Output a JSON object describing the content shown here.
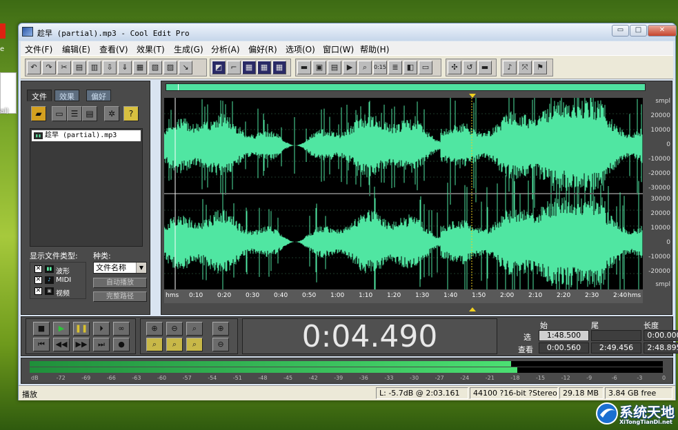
{
  "desktop": {
    "left_label": "al)"
  },
  "window": {
    "title": "趁早 (partial).mp3 - Cool Edit Pro"
  },
  "window_buttons": {
    "minimize": "▭",
    "maximize": "□",
    "close": "✕"
  },
  "menu": [
    {
      "label": "文件(F)"
    },
    {
      "label": "编辑(E)"
    },
    {
      "label": "查看(V)"
    },
    {
      "label": "效果(T)"
    },
    {
      "label": "生成(G)"
    },
    {
      "label": "分析(A)"
    },
    {
      "label": "偏好(R)"
    },
    {
      "label": "选项(O)"
    },
    {
      "label": "窗口(W)"
    },
    {
      "label": "帮助(H)"
    }
  ],
  "toolbar_icons": [
    "undo-icon",
    "redo-icon",
    "cut-icon",
    "copy-icon",
    "paste-icon",
    "paste-new-icon",
    "mix-paste-icon",
    "trim-icon",
    "save-icon",
    "import-icon",
    "export-icon",
    "envelope-icon",
    "scale-icon",
    "grid-icon",
    "grid2-icon",
    "grid3-icon",
    "view-wave-icon",
    "view-spectral-icon",
    "view-pan-icon",
    "play-view-icon",
    "zoom-view-icon",
    "time-icon",
    "bars-icon",
    "color-icon",
    "blank-icon",
    "fx-icon",
    "loop-icon",
    "minus-icon",
    "cd-icon",
    "snap-icon",
    "flag-icon"
  ],
  "left_panel": {
    "tabs": [
      "文件",
      "效果",
      "偏好"
    ],
    "files": [
      {
        "name": "趁早 (partial).mp3"
      }
    ],
    "show_types_label": "显示文件类型:",
    "sort_label": "种类:",
    "file_types": [
      {
        "label": "波形",
        "checked": "✕"
      },
      {
        "label": "MIDI",
        "checked": "✕"
      },
      {
        "label": "视频",
        "checked": "✕"
      }
    ],
    "sort_value": "文件名称",
    "auto_play": "自动播放",
    "full_path": "完整路径"
  },
  "waveform": {
    "top_unit": "smpl",
    "bottom_unit": "smpl",
    "channel1_scale": [
      "20000",
      "10000",
      "0",
      "-10000",
      "-20000",
      "-30000"
    ],
    "channel2_scale": [
      "30000",
      "20000",
      "10000",
      "0",
      "-10000",
      "-20000"
    ],
    "time_labels": [
      "hms",
      "0:10",
      "0:20",
      "0:30",
      "0:40",
      "0:50",
      "1:00",
      "1:10",
      "1:20",
      "1:30",
      "1:40",
      "1:50",
      "2:00",
      "2:10",
      "2:20",
      "2:30",
      "2:40",
      "hms"
    ],
    "color": "#50e6a2"
  },
  "transport": {
    "time": "0:04.490"
  },
  "selection": {
    "headers": [
      "始",
      "尾",
      "长度"
    ],
    "rows": [
      {
        "label": "选",
        "begin": "1:48.500",
        "end": "",
        "length": "0:00.000"
      },
      {
        "label": "查看",
        "begin": "0:00.560",
        "end": "2:49.456",
        "length": "2:48.895"
      }
    ]
  },
  "meters": {
    "db_labels": [
      "dB",
      "-72",
      "-69",
      "-66",
      "-63",
      "-60",
      "-57",
      "-54",
      "-51",
      "-48",
      "-45",
      "-42",
      "-39",
      "-36",
      "-33",
      "-30",
      "-27",
      "-24",
      "-21",
      "-18",
      "-15",
      "-12",
      "-9",
      "-6",
      "-3",
      "0"
    ],
    "left_level": 0.76,
    "right_level": 0.77
  },
  "status": {
    "left": "播放",
    "level": "L: -5.7dB @  2:03.161",
    "format": "44100 ?16-bit ?Stereo",
    "size": "29.18 MB",
    "free": "3.84 GB free"
  },
  "logo": {
    "text": "系统天地",
    "sub": "XiTongTianDi.net"
  }
}
